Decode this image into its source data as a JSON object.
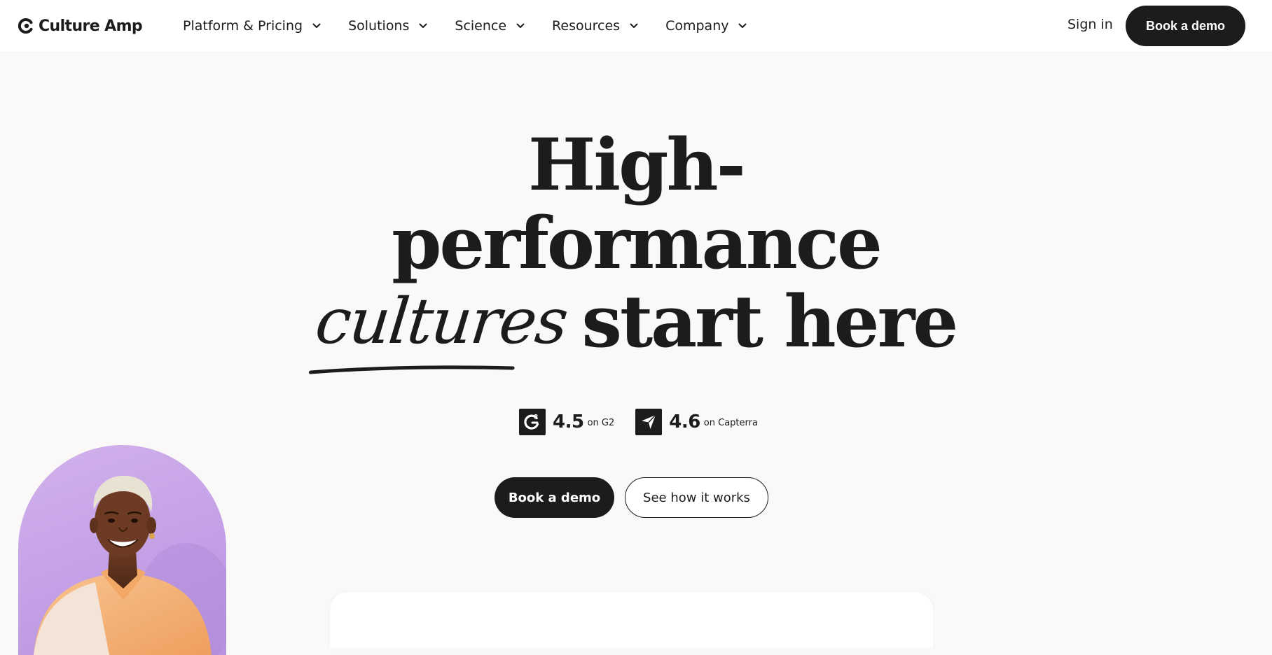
{
  "brand": {
    "name": "Culture Amp",
    "logo_icon": "culture-amp-logo-icon"
  },
  "nav": {
    "items": [
      {
        "label": "Platform & Pricing",
        "icon": "chevron-down-icon"
      },
      {
        "label": "Solutions",
        "icon": "chevron-down-icon"
      },
      {
        "label": "Science",
        "icon": "chevron-down-icon"
      },
      {
        "label": "Resources",
        "icon": "chevron-down-icon"
      },
      {
        "label": "Company",
        "icon": "chevron-down-icon"
      }
    ],
    "sign_in": "Sign in",
    "book_demo": "Book a demo"
  },
  "hero": {
    "headline_line1": "High-",
    "headline_line2": "performance",
    "headline_script_word": "cultures",
    "headline_line3_rest": "start here"
  },
  "ratings": [
    {
      "score": "4.5",
      "source": "on G2",
      "icon": "g2-logo-icon"
    },
    {
      "score": "4.6",
      "source": "on Capterra",
      "icon": "capterra-logo-icon"
    }
  ],
  "cta": {
    "primary": "Book a demo",
    "secondary": "See how it works"
  },
  "colors": {
    "page_background": "#faf9f7",
    "header_background": "#ffffff",
    "primary_dark": "#1c1c1c",
    "portrait_background": "#c9a6e9",
    "shirt": "#f5b27a"
  }
}
